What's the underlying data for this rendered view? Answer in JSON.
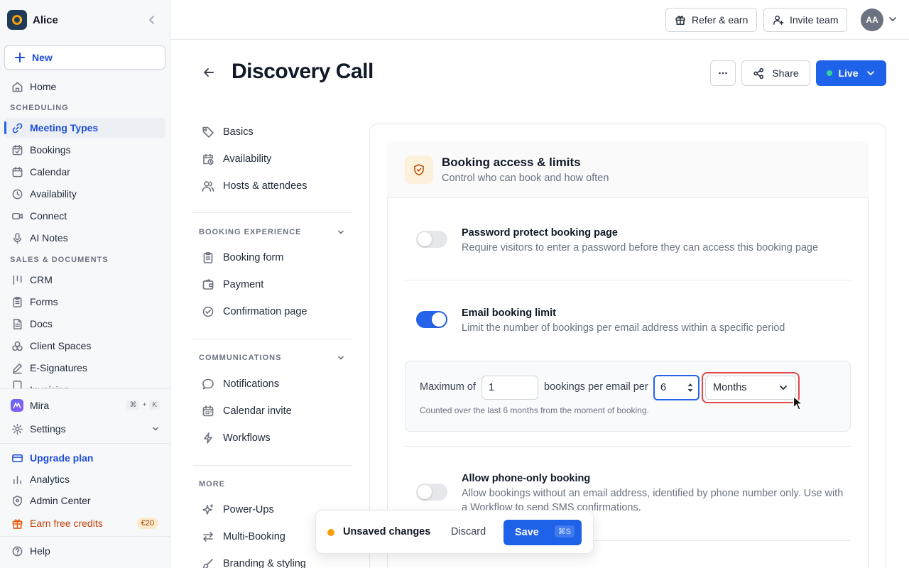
{
  "workspace": {
    "name": "Alice"
  },
  "sidebar": {
    "new_label": "New",
    "home_label": "Home",
    "scheduling_label": "SCHEDULING",
    "scheduling_items": [
      "Meeting Types",
      "Bookings",
      "Calendar",
      "Availability",
      "Connect",
      "AI Notes"
    ],
    "sales_label": "SALES & DOCUMENTS",
    "sales_items": [
      "CRM",
      "Forms",
      "Docs",
      "Client Spaces",
      "E-Signatures",
      "Invoicing"
    ],
    "mira_label": "Mira",
    "mira_shortcut": [
      "⌘",
      "+",
      "K"
    ],
    "settings_label": "Settings",
    "upgrade_label": "Upgrade plan",
    "analytics_label": "Analytics",
    "admin_label": "Admin Center",
    "credits_label": "Earn free credits",
    "credits_badge": "€20",
    "help_label": "Help",
    "accent_color": "#1d4ed8"
  },
  "topbar": {
    "refer_label": "Refer & earn",
    "invite_label": "Invite team",
    "avatar_initials": "AA"
  },
  "page": {
    "title": "Discovery Call",
    "share_label": "Share",
    "status_label": "Live"
  },
  "subnav": {
    "top_items": [
      "Basics",
      "Availability",
      "Hosts & attendees"
    ],
    "booking_experience_label": "BOOKING EXPERIENCE",
    "booking_items": [
      "Booking form",
      "Payment",
      "Confirmation page"
    ],
    "communications_label": "COMMUNICATIONS",
    "comm_items": [
      "Notifications",
      "Calendar invite",
      "Workflows"
    ],
    "more_label": "MORE",
    "more_items": [
      "Power-Ups",
      "Multi-Booking",
      "Branding & styling"
    ]
  },
  "section": {
    "title": "Booking access & limits",
    "subtitle": "Control who can book and how often",
    "password": {
      "title": "Password protect booking page",
      "desc": "Require visitors to enter a password before they can access this booking page",
      "enabled": false
    },
    "email_limit": {
      "title": "Email booking limit",
      "desc": "Limit the number of bookings per email address within a specific period",
      "enabled": true,
      "max_prefix": "Maximum of",
      "max_value": "1",
      "per_label": "bookings per email per",
      "period_value": "6",
      "period_unit": "Months",
      "note": "Counted over the last 6 months from the moment of booking."
    },
    "phone_only": {
      "title": "Allow phone-only booking",
      "desc": "Allow bookings without an email address, identified by phone number only. Use with a Workflow to send SMS confirmations.",
      "enabled": false
    }
  },
  "unsaved_bar": {
    "text": "Unsaved changes",
    "discard_label": "Discard",
    "save_label": "Save",
    "save_shortcut": "⌘S"
  }
}
